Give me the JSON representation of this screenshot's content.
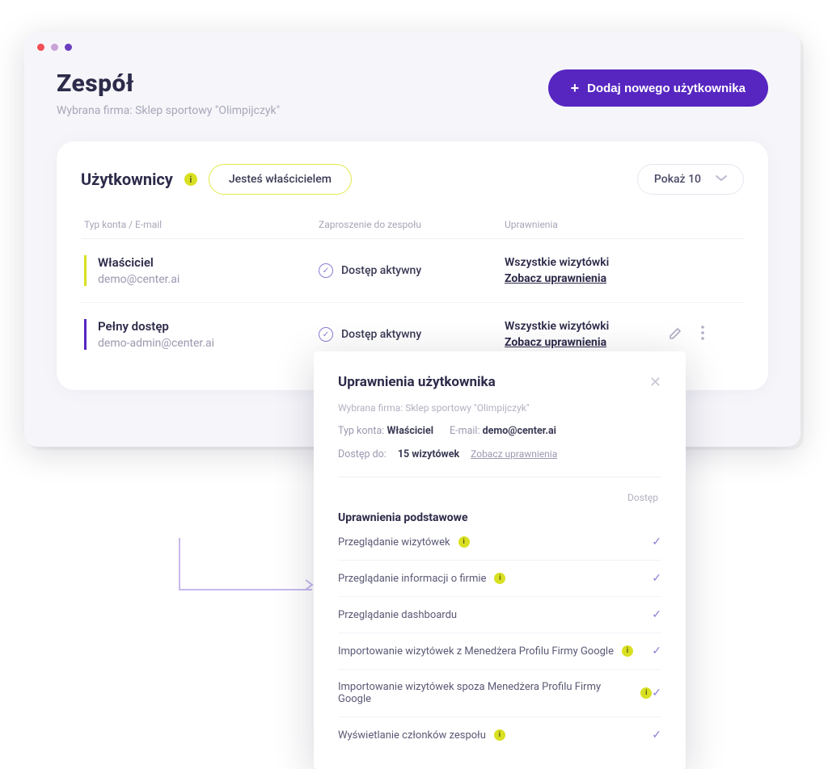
{
  "header": {
    "title": "Zespół",
    "subtitle": "Wybrana firma: Sklep sportowy \"Olimpijczyk\"",
    "add_button": "Dodaj nowego użytkownika"
  },
  "card": {
    "title": "Użytkownicy",
    "owner_pill": "Jesteś właścicielem",
    "page_size": "Pokaż 10"
  },
  "table": {
    "head_account": "Typ konta / E-mail",
    "head_invite": "Zaproszenie do zespołu",
    "head_perms": "Uprawnienia",
    "status_active": "Dostęp aktywny",
    "perm_all": "Wszystkie wizytówki",
    "perm_link": "Zobacz uprawnienia"
  },
  "rows": [
    {
      "type": "Właściciel",
      "email": "demo@center.ai"
    },
    {
      "type": "Pełny dostęp",
      "email": "demo-admin@center.ai"
    }
  ],
  "popover": {
    "title": "Uprawnienia użytkownika",
    "subtitle": "Wybrana firma: Sklep sportowy \"Olimpijczyk\"",
    "type_label": "Typ konta:",
    "type_value": "Właściciel",
    "email_label": "E-mail:",
    "email_value": "demo@center.ai",
    "access_label": "Dostęp do:",
    "access_value": "15 wizytówek",
    "access_link": "Zobacz uprawnienia",
    "col_access": "Dostęp",
    "group_title": "Uprawnienia podstawowe",
    "perms": [
      {
        "label": "Przeglądanie wizytówek",
        "info": true
      },
      {
        "label": "Przeglądanie informacji o firmie",
        "info": true
      },
      {
        "label": "Przeglądanie dashboardu",
        "info": false
      },
      {
        "label": "Importowanie wizytówek z Menedżera Profilu Firmy Google",
        "info": true
      },
      {
        "label": "Importowanie wizytówek spoza Menedżera Profilu Firmy Google",
        "info": true
      },
      {
        "label": "Wyświetlanie członków zespołu",
        "info": true
      }
    ]
  }
}
